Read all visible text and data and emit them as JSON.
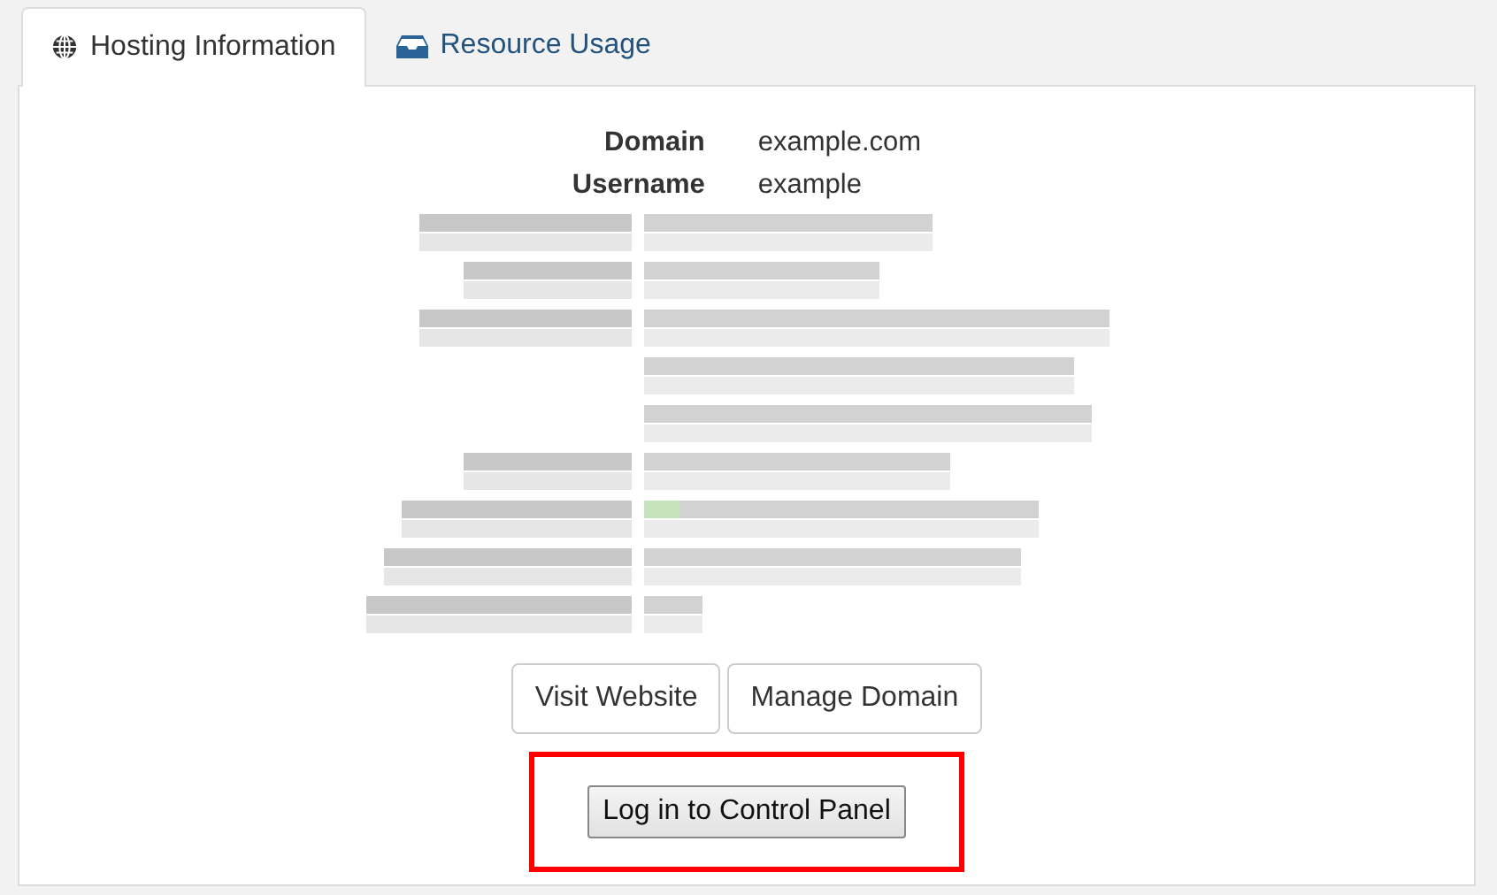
{
  "tabs": [
    {
      "label": "Hosting Information",
      "selected": true
    },
    {
      "label": "Resource Usage",
      "selected": false
    }
  ],
  "details": [
    {
      "label": "Domain",
      "value": "example.com"
    },
    {
      "label": "Username",
      "value": "example"
    }
  ],
  "blurred_details": {
    "redacted": true
  },
  "buttons": [
    "Visit Website",
    "Manage Domain"
  ],
  "login_button": {
    "label": "Log in to Control Panel",
    "highlighted": true
  }
}
